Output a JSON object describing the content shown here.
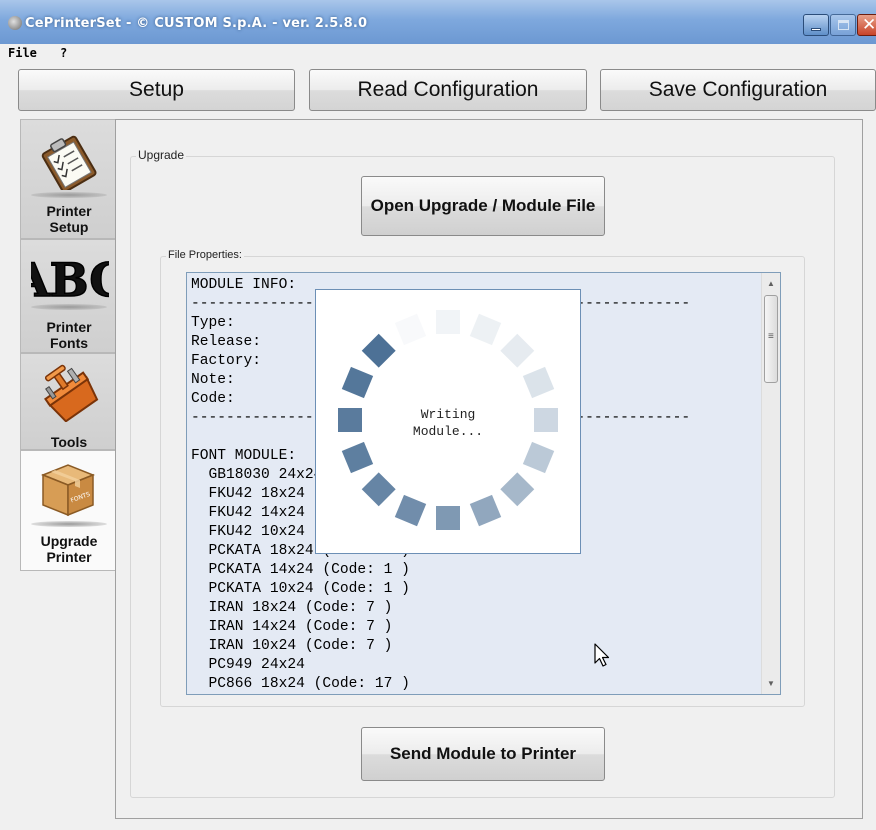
{
  "window": {
    "title": "CePrinterSet - © CUSTOM S.p.A. - ver. 2.5.8.0",
    "close_glyph": "✕"
  },
  "menu": {
    "items": [
      "File",
      "?"
    ]
  },
  "toolbar": {
    "setup_label": "Setup",
    "read_label": "Read Configuration",
    "save_label": "Save Configuration"
  },
  "sidebar": {
    "items": [
      {
        "label": "Printer\nSetup",
        "icon": "clipboard-icon"
      },
      {
        "label": "Printer\nFonts",
        "icon": "abc-font-icon",
        "icon_text": "ABC"
      },
      {
        "label": "Tools",
        "icon": "toolbox-icon"
      },
      {
        "label": "Upgrade\nPrinter",
        "icon": "box-icon",
        "icon_text": "FONTS"
      }
    ],
    "active_index": 3
  },
  "upgrade": {
    "group_label": "Upgrade",
    "open_button": "Open Upgrade / Module File",
    "properties_label": "File Properties:",
    "send_button": "Send Module to Printer"
  },
  "file_properties": {
    "lines": [
      "MODULE INFO:",
      "---------------------------------------------------------",
      "Type:",
      "Release:",
      "Factory:",
      "Note:",
      "Code:",
      "---------------------------------------------------------",
      "",
      "FONT MODULE:",
      "  GB18030 24x24",
      "  FKU42 18x24",
      "  FKU42 14x24",
      "  FKU42 10x24",
      "  PCKATA 18x24 (Code: 1 )",
      "  PCKATA 14x24 (Code: 1 )",
      "  PCKATA 10x24 (Code: 1 )",
      "  IRAN 18x24 (Code: 7 )",
      "  IRAN 14x24 (Code: 7 )",
      "  IRAN 10x24 (Code: 7 )",
      "  PC949 24x24",
      "  PC866 18x24 (Code: 17 )"
    ]
  },
  "progress": {
    "line1": "Writing",
    "line2": "Module..."
  },
  "colors": {
    "spinner": "#4d7196",
    "titlebar": "#7ea8dd",
    "text_area": "#e4eaf4"
  }
}
